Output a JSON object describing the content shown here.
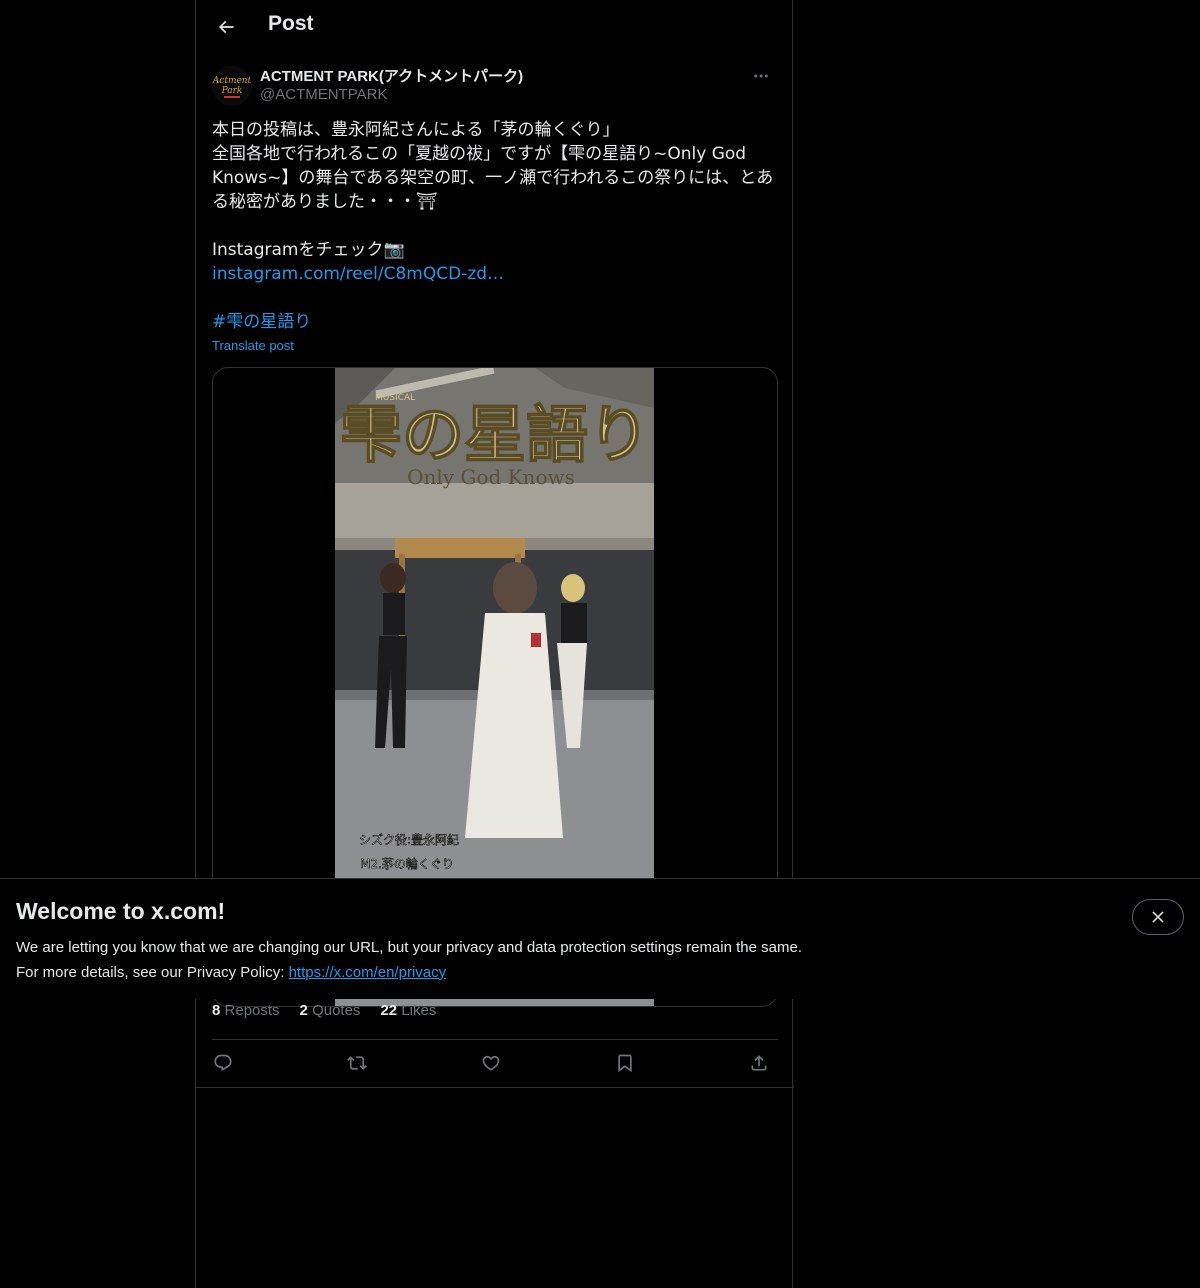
{
  "header": {
    "title": "Post"
  },
  "author": {
    "name": "ACTMENT PARK(アクトメントパーク)",
    "handle": "@ACTMENTPARK",
    "avatar_text_line1": "Actment",
    "avatar_text_line2": "Park"
  },
  "post": {
    "line1": "本日の投稿は、豊永阿紀さんによる「茅の輪くぐり」",
    "line2": "全国各地で行われるこの「夏越の祓」ですが【雫の星語り~Only God Knows~】の舞台である架空の町、一ノ瀬で行われるこの祭りには、とある秘密がありました・・・⛩",
    "line3": "Instagramをチェック📷",
    "link": "instagram.com/reel/C8mQCD-zd…",
    "hashtag": "#雫の星語り",
    "translate": "Translate post"
  },
  "media": {
    "logo_small": "MUSICAL",
    "logo_title": "雫の星語り",
    "logo_subtitle": "Only God Knows",
    "caption_line1": "シズク役:豊永阿紀",
    "caption_line2": "M2.茅の輪くぐり"
  },
  "stats": {
    "reposts_count": "8",
    "reposts_label": "Reposts",
    "quotes_count": "2",
    "quotes_label": "Quotes",
    "likes_count": "22",
    "likes_label": "Likes"
  },
  "actions": [
    "reply-icon",
    "repost-icon",
    "like-icon",
    "bookmark-icon",
    "share-icon"
  ],
  "banner": {
    "title": "Welcome to x.com!",
    "body_line1": "We are letting you know that we are changing our URL, but your privacy and data protection settings remain the same.",
    "body_line2_prefix": "For more details, see our Privacy Policy: ",
    "privacy_link": "https://x.com/en/privacy"
  },
  "colors": {
    "background": "#000000",
    "text": "#e7e9ea",
    "secondary": "#71767b",
    "accent": "#1d9bf0",
    "border": "#2f3336"
  }
}
